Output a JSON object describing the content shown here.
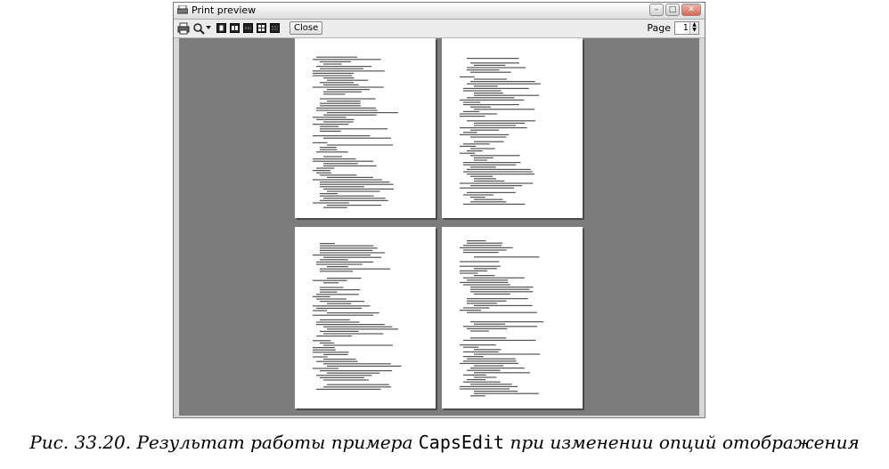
{
  "window": {
    "title": "Print preview"
  },
  "toolbar": {
    "close_label": "Close",
    "page_label": "Page",
    "page_value": "1",
    "icons": [
      "printer-icon",
      "zoom-icon",
      "dropdown-arrow-icon",
      "one-page-icon",
      "two-page-icon",
      "three-page-icon",
      "four-page-icon",
      "six-page-icon"
    ]
  },
  "preview": {
    "pages_shown": 4
  },
  "caption": {
    "prefix": "Рис. 33.20. Результат работы примера ",
    "code": "CapsEdit",
    "suffix": " при изменении опций отображения"
  }
}
